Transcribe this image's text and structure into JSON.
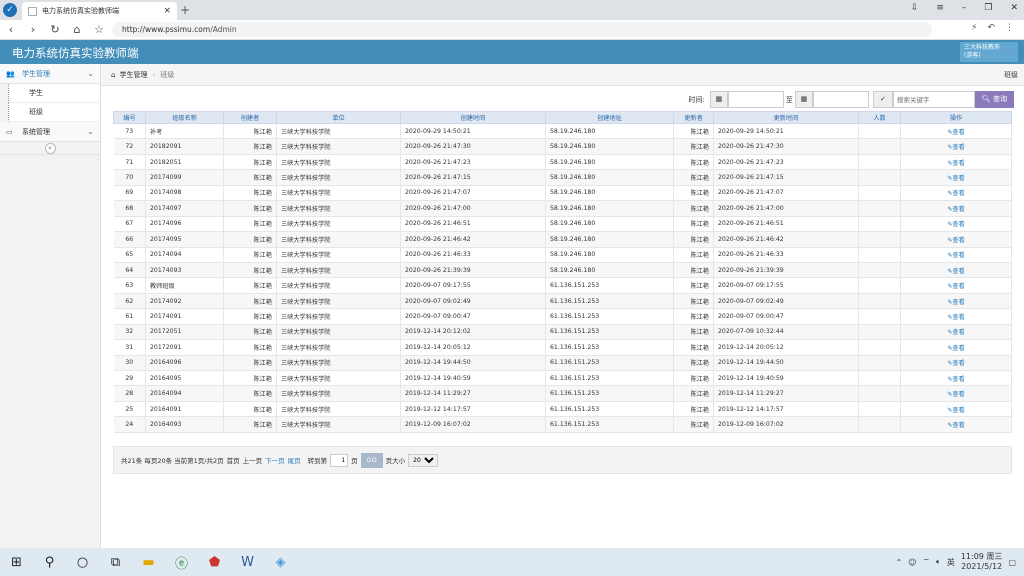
{
  "browser": {
    "tab_title": "电力系统仿真实验教师端",
    "url_host": "http://www.pssimu.com",
    "url_path": "/Admin"
  },
  "header": {
    "brand": "电力系统仿真实验教师端",
    "user_line1": "三大科技教务",
    "user_line2": "(游客)"
  },
  "sidebar": {
    "group1": "学生管理",
    "sub1": "学生",
    "sub2": "班级",
    "group2": "系统管理"
  },
  "breadcrumb": {
    "home": "学生管理",
    "current": "班级",
    "page_title": "班级"
  },
  "filter": {
    "time_label": "时间:",
    "to_label": "至",
    "search_placeholder": "搜索关键字",
    "query_label": "查询"
  },
  "table": {
    "headers": [
      "编号",
      "班级名称",
      "创建者",
      "单位",
      "创建时间",
      "创建地址",
      "更新者",
      "更新时间",
      "人数",
      "操作"
    ],
    "action_label": "查看",
    "rows": [
      [
        "73",
        "补考",
        "陈江艳",
        "三峡大学科技学院",
        "2020-09-29 14:50:21",
        "58.19.246.180",
        "陈江艳",
        "2020-09-29 14:50:21",
        ""
      ],
      [
        "72",
        "20182091",
        "陈江艳",
        "三峡大学科技学院",
        "2020-09-26 21:47:30",
        "58.19.246.180",
        "陈江艳",
        "2020-09-26 21:47:30",
        ""
      ],
      [
        "71",
        "20182051",
        "陈江艳",
        "三峡大学科技学院",
        "2020-09-26 21:47:23",
        "58.19.246.180",
        "陈江艳",
        "2020-09-26 21:47:23",
        ""
      ],
      [
        "70",
        "20174099",
        "陈江艳",
        "三峡大学科技学院",
        "2020-09-26 21:47:15",
        "58.19.246.180",
        "陈江艳",
        "2020-09-26 21:47:15",
        ""
      ],
      [
        "69",
        "20174098",
        "陈江艳",
        "三峡大学科技学院",
        "2020-09-26 21:47:07",
        "58.19.246.180",
        "陈江艳",
        "2020-09-26 21:47:07",
        ""
      ],
      [
        "68",
        "20174097",
        "陈江艳",
        "三峡大学科技学院",
        "2020-09-26 21:47:00",
        "58.19.246.180",
        "陈江艳",
        "2020-09-26 21:47:00",
        ""
      ],
      [
        "67",
        "20174096",
        "陈江艳",
        "三峡大学科技学院",
        "2020-09-26 21:46:51",
        "58.19.246.180",
        "陈江艳",
        "2020-09-26 21:46:51",
        ""
      ],
      [
        "66",
        "20174095",
        "陈江艳",
        "三峡大学科技学院",
        "2020-09-26 21:46:42",
        "58.19.246.180",
        "陈江艳",
        "2020-09-26 21:46:42",
        ""
      ],
      [
        "65",
        "20174094",
        "陈江艳",
        "三峡大学科技学院",
        "2020-09-26 21:46:33",
        "58.19.246.180",
        "陈江艳",
        "2020-09-26 21:46:33",
        ""
      ],
      [
        "64",
        "20174093",
        "陈江艳",
        "三峡大学科技学院",
        "2020-09-26 21:39:39",
        "58.19.246.180",
        "陈江艳",
        "2020-09-26 21:39:39",
        ""
      ],
      [
        "63",
        "教师班级",
        "陈江艳",
        "三峡大学科技学院",
        "2020-09-07 09:17:55",
        "61.136.151.253",
        "陈江艳",
        "2020-09-07 09:17:55",
        ""
      ],
      [
        "62",
        "20174092",
        "陈江艳",
        "三峡大学科技学院",
        "2020-09-07 09:02:49",
        "61.136.151.253",
        "陈江艳",
        "2020-09-07 09:02:49",
        ""
      ],
      [
        "61",
        "20174091",
        "陈江艳",
        "三峡大学科技学院",
        "2020-09-07 09:00:47",
        "61.136.151.253",
        "陈江艳",
        "2020-09-07 09:00:47",
        ""
      ],
      [
        "32",
        "20172051",
        "陈江艳",
        "三峡大学科技学院",
        "2019-12-14 20:12:02",
        "61.136.151.253",
        "陈江艳",
        "2020-07-09 10:32:44",
        ""
      ],
      [
        "31",
        "20172091",
        "陈江艳",
        "三峡大学科技学院",
        "2019-12-14 20:05:12",
        "61.136.151.253",
        "陈江艳",
        "2019-12-14 20:05:12",
        ""
      ],
      [
        "30",
        "20164096",
        "陈江艳",
        "三峡大学科技学院",
        "2019-12-14 19:44:50",
        "61.136.151.253",
        "陈江艳",
        "2019-12-14 19:44:50",
        ""
      ],
      [
        "29",
        "20164095",
        "陈江艳",
        "三峡大学科技学院",
        "2019-12-14 19:40:59",
        "61.136.151.253",
        "陈江艳",
        "2019-12-14 19:40:59",
        ""
      ],
      [
        "28",
        "20164094",
        "陈江艳",
        "三峡大学科技学院",
        "2019-12-14 11:29:27",
        "61.136.151.253",
        "陈江艳",
        "2019-12-14 11:29:27",
        ""
      ],
      [
        "25",
        "20164091",
        "陈江艳",
        "三峡大学科技学院",
        "2019-12-12 14:17:57",
        "61.136.151.253",
        "陈江艳",
        "2019-12-12 14:17:57",
        ""
      ],
      [
        "24",
        "20164093",
        "陈江艳",
        "三峡大学科技学院",
        "2019-12-09 16:07:02",
        "61.136.151.253",
        "陈江艳",
        "2019-12-09 16:07:02",
        ""
      ]
    ]
  },
  "pager": {
    "summary": "共21条 每页20条 当前第1页/共2页",
    "first": "首页",
    "prev": "上一页",
    "next": "下一页",
    "last": "尾页",
    "goto_label": "转到第",
    "page_value": "1",
    "page_unit": "页",
    "go": "GO",
    "size_label": "页大小",
    "size_value": "20"
  },
  "taskbar": {
    "time": "11:09 周三",
    "date": "2021/5/12",
    "ime": "英"
  },
  "colors": {
    "header_bg": "#438eb9",
    "query_btn": "#8b7bbd",
    "link": "#2b7dbc"
  }
}
